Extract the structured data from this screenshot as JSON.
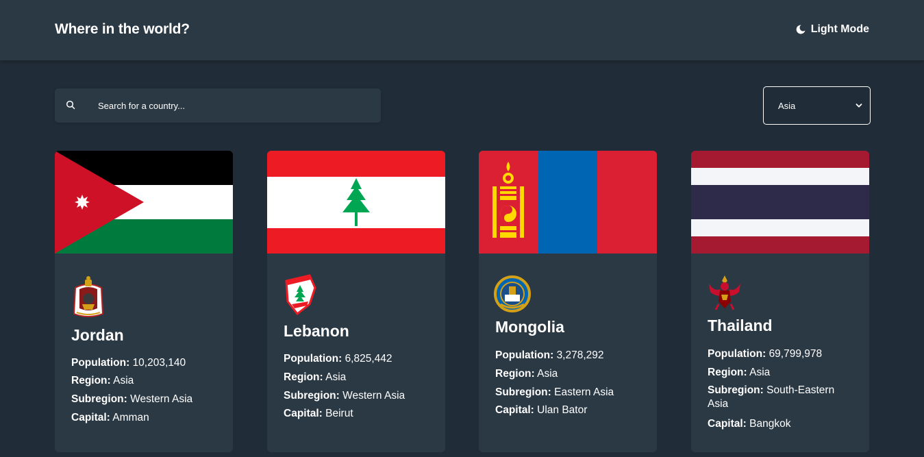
{
  "header": {
    "title": "Where in the world?",
    "mode_toggle_label": "Light Mode"
  },
  "search": {
    "placeholder": "Search for a country..."
  },
  "filter": {
    "selected": "Asia"
  },
  "labels": {
    "population": "Population:",
    "region": "Region:",
    "subregion": "Subregion:",
    "capital": "Capital:"
  },
  "countries": [
    {
      "name": "Jordan",
      "population": "10,203,140",
      "region": "Asia",
      "subregion": "Western Asia",
      "capital": "Amman"
    },
    {
      "name": "Lebanon",
      "population": "6,825,442",
      "region": "Asia",
      "subregion": "Western Asia",
      "capital": "Beirut"
    },
    {
      "name": "Mongolia",
      "population": "3,278,292",
      "region": "Asia",
      "subregion": "Eastern Asia",
      "capital": "Ulan Bator"
    },
    {
      "name": "Thailand",
      "population": "69,799,978",
      "region": "Asia",
      "subregion": "South-Eastern Asia",
      "capital": "Bangkok"
    }
  ],
  "colors": {
    "background": "#202c37",
    "surface": "#2b3945",
    "text": "#ffffff"
  }
}
